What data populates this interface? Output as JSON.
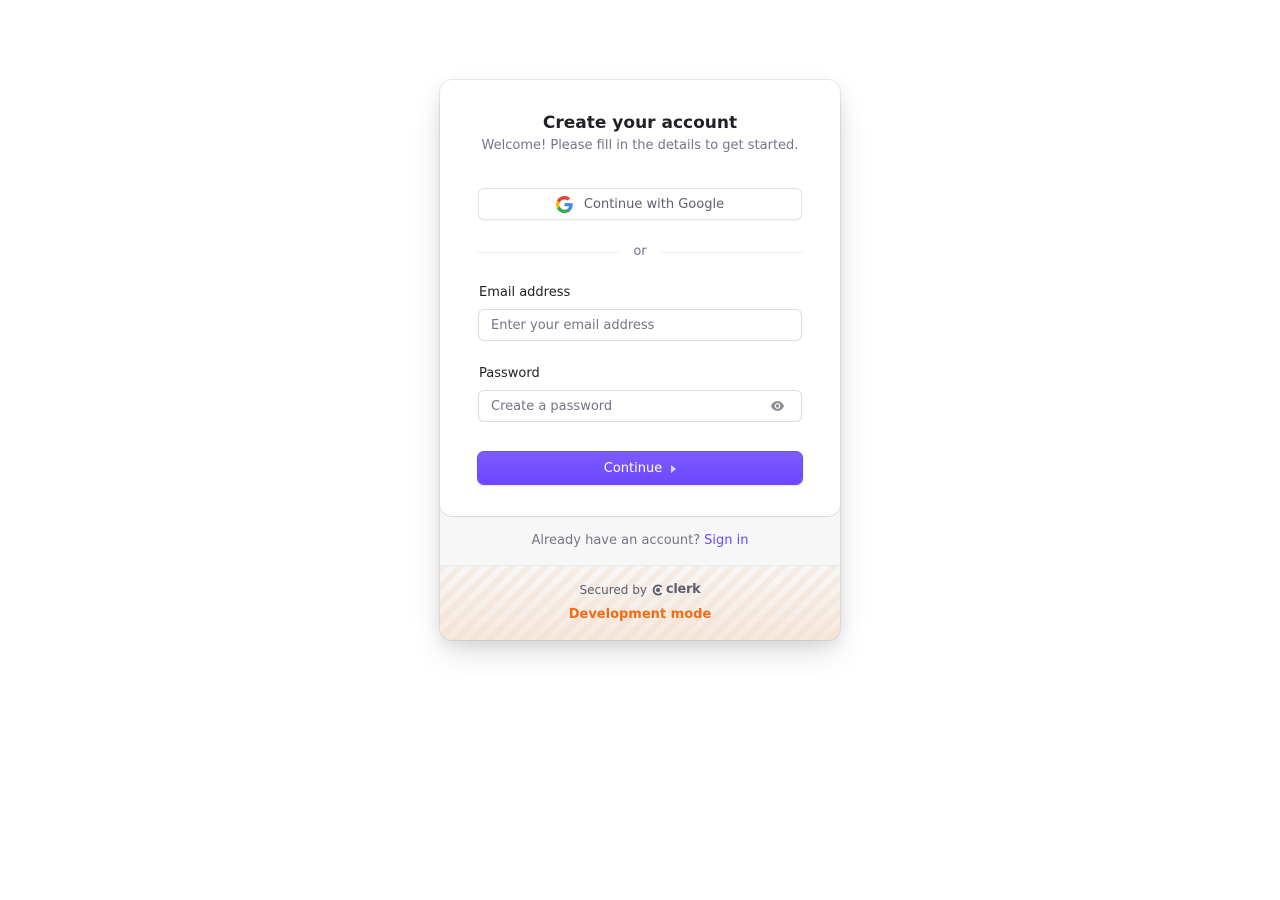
{
  "header": {
    "title": "Create your account",
    "subtitle": "Welcome! Please fill in the details to get started."
  },
  "social": {
    "google_label": "Continue with Google",
    "google_icon": "google-icon"
  },
  "divider": {
    "text": "or"
  },
  "form": {
    "email": {
      "label": "Email address",
      "placeholder": "Enter your email address",
      "value": ""
    },
    "password": {
      "label": "Password",
      "placeholder": "Create a password",
      "value": "",
      "toggle_icon": "eye-icon"
    },
    "continue_label": "Continue",
    "continue_icon": "triangle-right-icon"
  },
  "footer": {
    "prompt": "Already have an account?",
    "signin_link": "Sign in",
    "secured_by": "Secured by",
    "brand": "clerk",
    "dev_mode": "Development mode"
  },
  "colors": {
    "accent": "#6c47ff",
    "dev_mode": "#f36b16",
    "muted_text": "#747686",
    "title_text": "#212126"
  }
}
